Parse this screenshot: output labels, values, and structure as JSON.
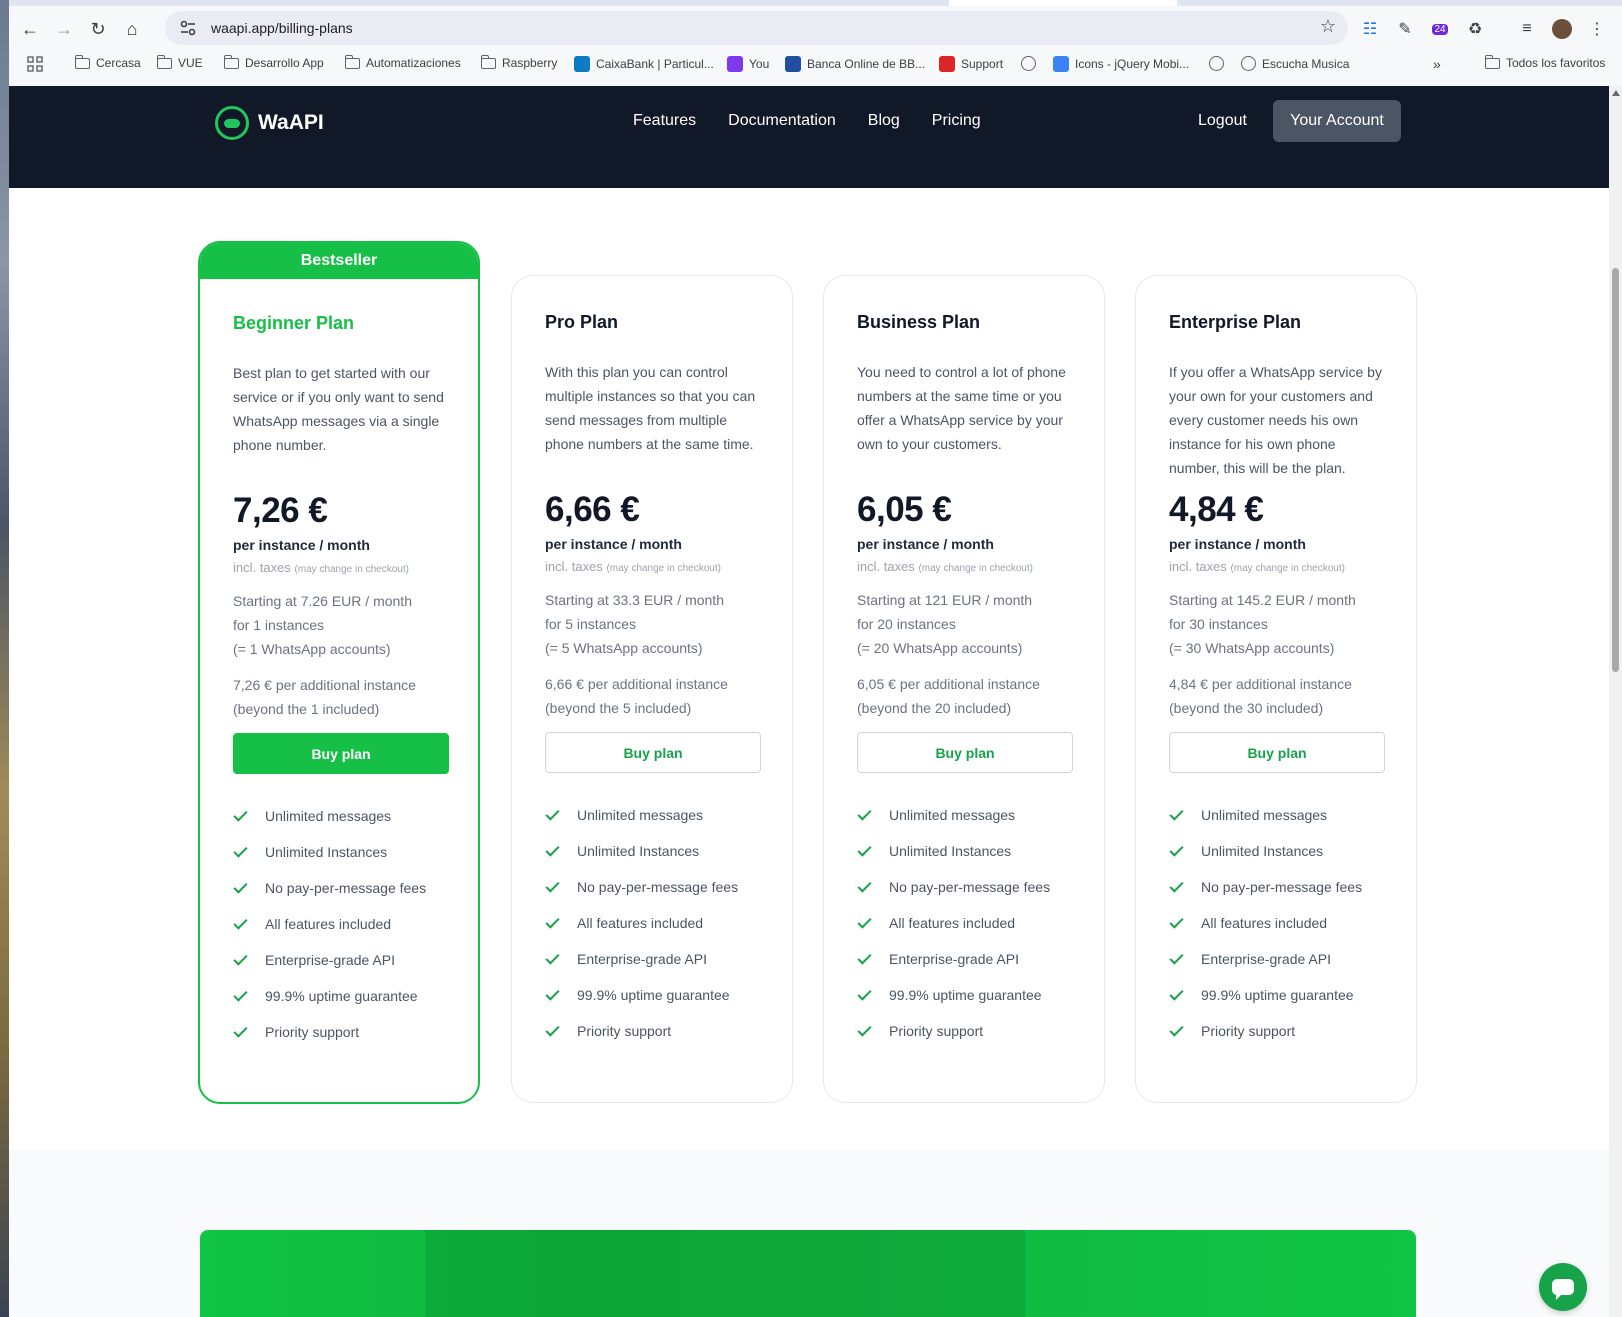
{
  "browser": {
    "url": "waapi.app/billing-plans",
    "bookmarks": [
      {
        "label": "Cercasa",
        "type": "folder"
      },
      {
        "label": "VUE",
        "type": "folder"
      },
      {
        "label": "Desarrollo App",
        "type": "folder"
      },
      {
        "label": "Automatizaciones",
        "type": "folder"
      },
      {
        "label": "Raspberry",
        "type": "folder"
      },
      {
        "label": "CaixaBank | Particul...",
        "type": "site"
      },
      {
        "label": "You",
        "type": "site"
      },
      {
        "label": "Banca Online de BB...",
        "type": "site"
      },
      {
        "label": "Support",
        "type": "site"
      },
      {
        "label": "",
        "type": "globe"
      },
      {
        "label": "Icons - jQuery Mobi...",
        "type": "site"
      },
      {
        "label": "",
        "type": "globe"
      },
      {
        "label": "Escucha Musica",
        "type": "site"
      }
    ],
    "all_bookmarks": "Todos los favoritos",
    "extension_badge": "24"
  },
  "header": {
    "logo_text": "WaAPI",
    "nav": [
      "Features",
      "Documentation",
      "Blog",
      "Pricing"
    ],
    "logout": "Logout",
    "account": "Your Account"
  },
  "plans": [
    {
      "badge": "Bestseller",
      "name": "Beginner Plan",
      "desc": "Best plan to get started with our service or if you only want to send WhatsApp messages via a single phone number.",
      "price": "7,26 €",
      "per": "per instance / month",
      "taxes": "incl. taxes",
      "taxes_note": "(may change in checkout)",
      "start_1": "Starting at 7.26 EUR / month",
      "start_2": "for 1 instances",
      "start_3": "(= 1 WhatsApp accounts)",
      "extra_1": "7,26 € per additional instance",
      "extra_2": "(beyond the 1 included)",
      "buy": "Buy plan"
    },
    {
      "name": "Pro Plan",
      "desc": "With this plan you can control multiple instances so that you can send messages from multiple phone numbers at the same time.",
      "price": "6,66 €",
      "per": "per instance / month",
      "taxes": "incl. taxes",
      "taxes_note": "(may change in checkout)",
      "start_1": "Starting at 33.3 EUR / month",
      "start_2": "for 5 instances",
      "start_3": "(= 5 WhatsApp accounts)",
      "extra_1": "6,66 € per additional instance",
      "extra_2": "(beyond the 5 included)",
      "buy": "Buy plan"
    },
    {
      "name": "Business Plan",
      "desc": "You need to control a lot of phone numbers at the same time or you offer a WhatsApp service by your own to your customers.",
      "price": "6,05 €",
      "per": "per instance / month",
      "taxes": "incl. taxes",
      "taxes_note": "(may change in checkout)",
      "start_1": "Starting at 121 EUR / month",
      "start_2": "for 20 instances",
      "start_3": "(= 20 WhatsApp accounts)",
      "extra_1": "6,05 € per additional instance",
      "extra_2": "(beyond the 20 included)",
      "buy": "Buy plan"
    },
    {
      "name": "Enterprise Plan",
      "desc": "If you offer a WhatsApp service by your own for your customers and every customer needs his own instance for his own phone number, this will be the plan.",
      "price": "4,84 €",
      "per": "per instance / month",
      "taxes": "incl. taxes",
      "taxes_note": "(may change in checkout)",
      "start_1": "Starting at 145.2 EUR / month",
      "start_2": "for 30 instances",
      "start_3": "(= 30 WhatsApp accounts)",
      "extra_1": "4,84 € per additional instance",
      "extra_2": "(beyond the 30 included)",
      "buy": "Buy plan"
    }
  ],
  "features": [
    "Unlimited messages",
    "Unlimited Instances",
    "No pay-per-message fees",
    "All features included",
    "Enterprise-grade API",
    "99.9% uptime guarantee",
    "Priority support"
  ],
  "colors": {
    "accent": "#16c047",
    "header_bg": "#111827",
    "account_btn": "#4b5563"
  }
}
